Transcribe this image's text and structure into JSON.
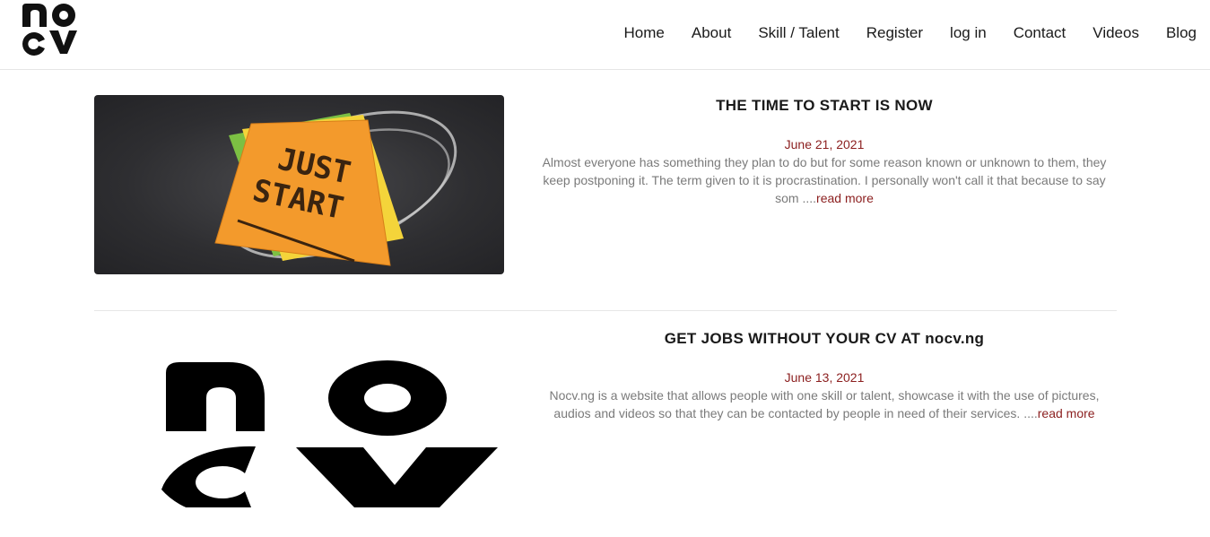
{
  "brand": {
    "logo_text": "nocv"
  },
  "nav": {
    "items": [
      {
        "label": "Home"
      },
      {
        "label": "About"
      },
      {
        "label": "Skill / Talent"
      },
      {
        "label": "Register"
      },
      {
        "label": "log in"
      },
      {
        "label": "Contact"
      },
      {
        "label": "Videos"
      },
      {
        "label": "Blog"
      }
    ]
  },
  "posts": [
    {
      "title": "THE TIME TO START IS NOW",
      "date": "June 21, 2021",
      "excerpt": "Almost everyone has something they plan to do but for some reason known or unknown to them, they keep postponing it. The term given to it is procrastination. I personally won't call it that because to say som ....",
      "read_more": "read more",
      "image_text": "JUST START"
    },
    {
      "title": "GET JOBS WITHOUT YOUR CV AT nocv.ng",
      "date": "June 13, 2021",
      "excerpt": "Nocv.ng is a website that allows people with one skill or talent, showcase it with the use of pictures, audios and videos so that they can be contacted by people in need of their services. ....",
      "read_more": "read more",
      "image_text": "nocv"
    }
  ]
}
